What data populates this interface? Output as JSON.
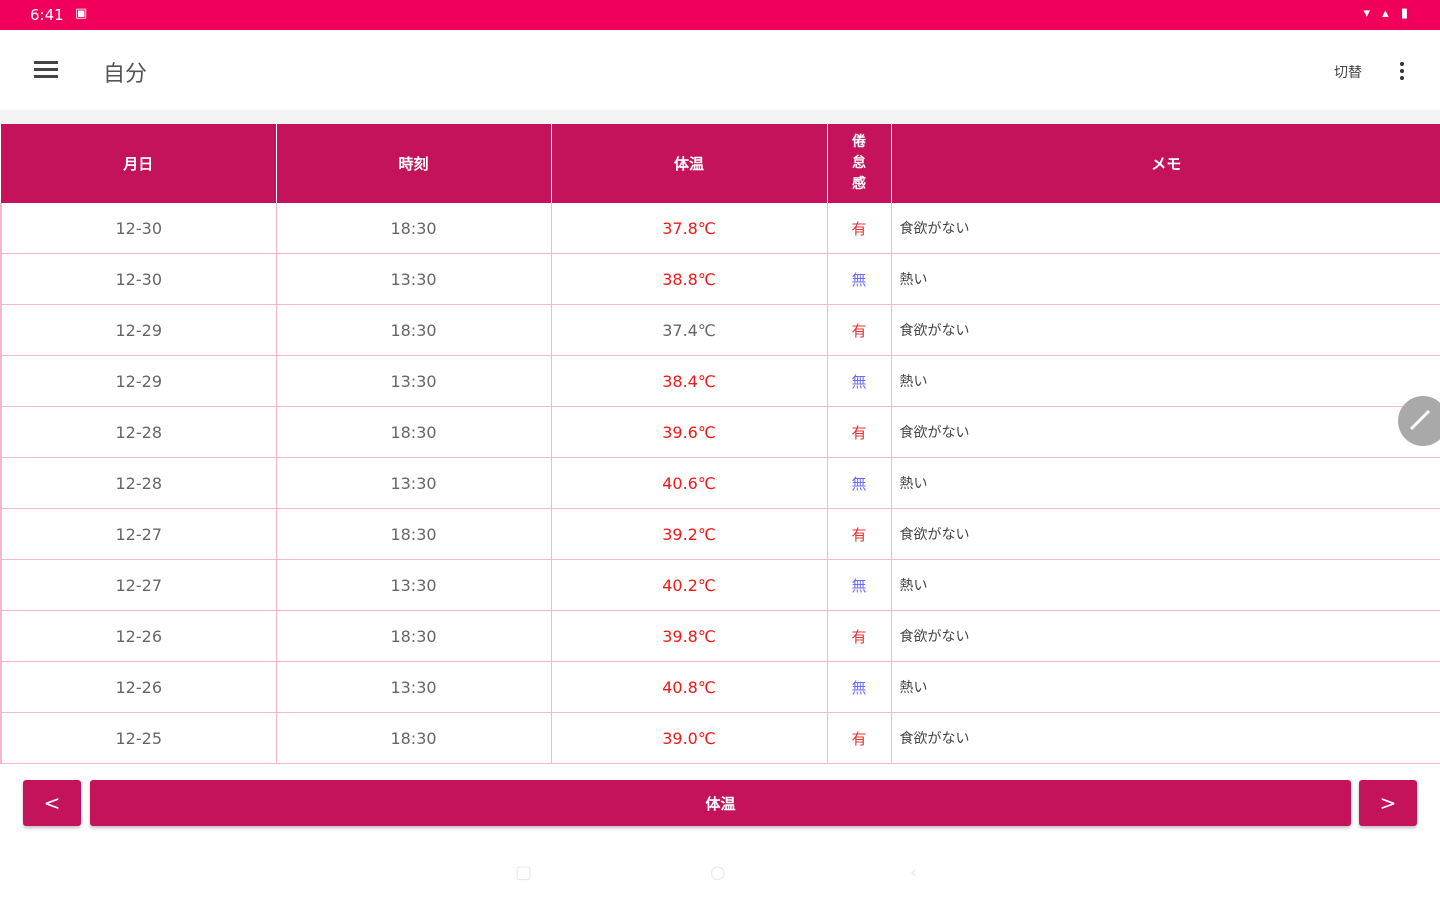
{
  "status_bar": {
    "time": "6:41",
    "sim_label": "▣",
    "icons": "▾ ▴ ▮"
  },
  "app_bar": {
    "title": "自分",
    "switch_label": "切替"
  },
  "table": {
    "headers": {
      "date": "月日",
      "time": "時刻",
      "temp": "体温",
      "flag": "倦\n怠\n感",
      "memo": "メモ"
    },
    "rows": [
      {
        "date": "12-30",
        "time": "18:30",
        "temp": "37.8℃",
        "flag": "有",
        "memo": "食欲がない"
      },
      {
        "date": "12-30",
        "time": "13:30",
        "temp": "38.8℃",
        "flag": "無",
        "memo": "熱い"
      },
      {
        "date": "12-29",
        "time": "18:30",
        "temp": "37.4℃",
        "flag": "有",
        "memo": "食欲がない"
      },
      {
        "date": "12-29",
        "time": "13:30",
        "temp": "38.4℃",
        "flag": "無",
        "memo": "熱い"
      },
      {
        "date": "12-28",
        "time": "18:30",
        "temp": "39.6℃",
        "flag": "有",
        "memo": "食欲がない"
      },
      {
        "date": "12-28",
        "time": "13:30",
        "temp": "40.6℃",
        "flag": "無",
        "memo": "熱い"
      },
      {
        "date": "12-27",
        "time": "18:30",
        "temp": "39.2℃",
        "flag": "有",
        "memo": "食欲がない"
      },
      {
        "date": "12-27",
        "time": "13:30",
        "temp": "40.2℃",
        "flag": "無",
        "memo": "熱い"
      },
      {
        "date": "12-26",
        "time": "18:30",
        "temp": "39.8℃",
        "flag": "有",
        "memo": "食欲がない"
      },
      {
        "date": "12-26",
        "time": "13:30",
        "temp": "40.8℃",
        "flag": "無",
        "memo": "熱い"
      },
      {
        "date": "12-25",
        "time": "18:30",
        "temp": "39.0℃",
        "flag": "有",
        "memo": "食欲がない"
      }
    ]
  },
  "bottom_nav": {
    "prev_label": "<",
    "center_label": "体温",
    "next_label": ">"
  },
  "colors": {
    "status_bar": "#f0005a",
    "accent": "#c4135b",
    "high_temp": "#f01818",
    "flag_yes": "#e53030",
    "flag_no": "#6b6bff",
    "grid_line": "#f5b8c9"
  },
  "icons": {
    "menu": "hamburger-icon",
    "more": "more-vert-icon",
    "edit": "pencil-icon"
  }
}
